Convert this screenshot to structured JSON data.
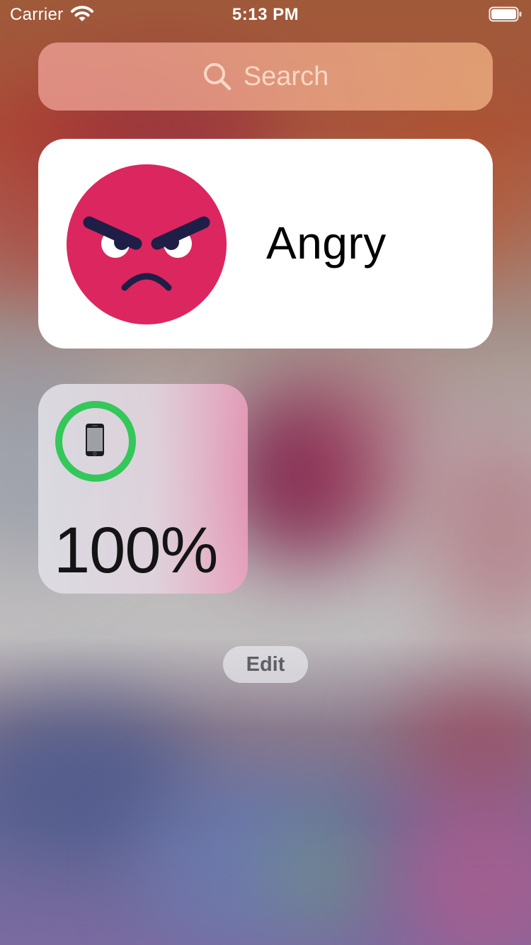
{
  "status_bar": {
    "carrier": "Carrier",
    "time": "5:13 PM",
    "wifi_icon": "wifi-icon",
    "battery_icon": "battery-full-icon"
  },
  "search": {
    "placeholder": "Search",
    "icon": "search-icon"
  },
  "widgets": {
    "mood": {
      "icon": "angry-face-icon",
      "label": "Angry",
      "face_color": "#dc2660"
    },
    "battery": {
      "device_icon": "iphone-icon",
      "level": 1.0,
      "percent_label": "100%",
      "ring_color": "#34c759"
    }
  },
  "edit_button": {
    "label": "Edit"
  }
}
